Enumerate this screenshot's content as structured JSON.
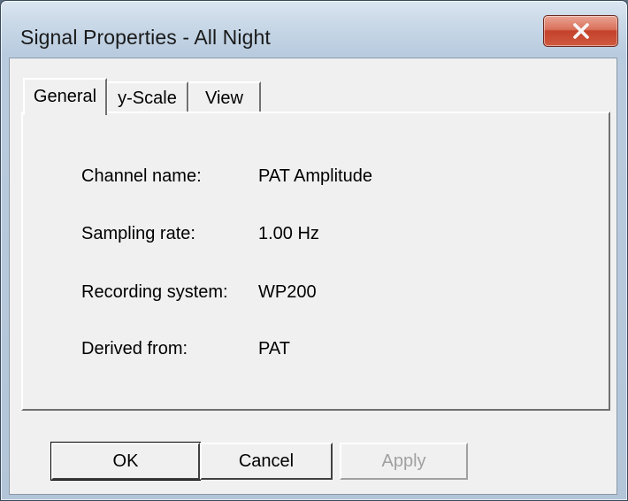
{
  "window": {
    "title": "Signal Properties - All Night",
    "close_icon": "close-x-icon"
  },
  "tabs": [
    {
      "label": "General",
      "active": true
    },
    {
      "label": "y-Scale",
      "active": false
    },
    {
      "label": "View",
      "active": false
    }
  ],
  "general": {
    "channel_name_label": "Channel name:",
    "channel_name_value": "PAT Amplitude",
    "sampling_rate_label": "Sampling rate:",
    "sampling_rate_value": "1.00 Hz",
    "recording_system_label": "Recording system:",
    "recording_system_value": "WP200",
    "derived_from_label": "Derived from:",
    "derived_from_value": "PAT"
  },
  "buttons": {
    "ok": "OK",
    "cancel": "Cancel",
    "apply": "Apply"
  }
}
